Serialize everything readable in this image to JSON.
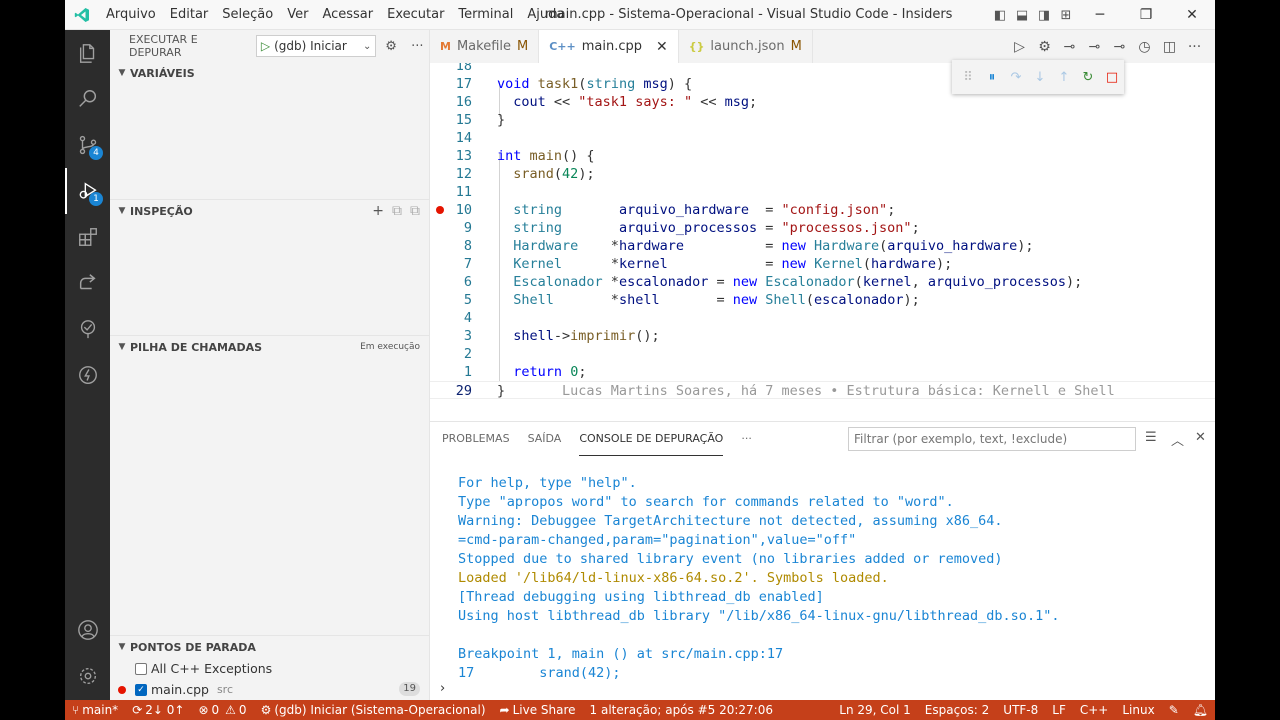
{
  "window_title": "main.cpp - Sistema-Operacional - Visual Studio Code - Insiders",
  "menu": [
    "Arquivo",
    "Editar",
    "Seleção",
    "Ver",
    "Acessar",
    "Executar",
    "Terminal",
    "Ajuda"
  ],
  "activity_badges": {
    "scm": "4",
    "debug": "1"
  },
  "sidebar": {
    "header": "EXECUTAR E DEPURAR",
    "config": "(gdb) Iniciar",
    "sections": {
      "variables": "VARIÁVEIS",
      "watch": "INSPEÇÃO",
      "callstack": "PILHA DE CHAMADAS",
      "callstack_status": "Em execução",
      "breakpoints": "PONTOS DE PARADA"
    },
    "breakpoints": [
      {
        "label": "All C++ Exceptions",
        "checked": false
      },
      {
        "label": "main.cpp",
        "path": "src",
        "line": "19",
        "checked": true
      }
    ]
  },
  "tabs": [
    {
      "icon": "M",
      "label": "Makefile",
      "status": "M",
      "active": false
    },
    {
      "icon": "C++",
      "label": "main.cpp",
      "status": "",
      "active": true
    },
    {
      "icon": "{}",
      "label": "launch.json",
      "status": "M",
      "active": false
    }
  ],
  "code_lines": [
    {
      "n": "18",
      "html": ""
    },
    {
      "n": "17",
      "html": "<span class='kw'>void</span> <span class='fn'>task1</span>(<span class='ty'>string</span> <span class='var'>msg</span>) {"
    },
    {
      "n": "16",
      "html": "  <span class='var'>cout</span> &lt;&lt; <span class='str'>\"task1 says: \"</span> &lt;&lt; <span class='var'>msg</span>;"
    },
    {
      "n": "15",
      "html": "}"
    },
    {
      "n": "14",
      "html": ""
    },
    {
      "n": "13",
      "html": "<span class='kw'>int</span> <span class='fn'>main</span>() {"
    },
    {
      "n": "12",
      "html": "  <span class='fn'>srand</span>(<span class='num'>42</span>);"
    },
    {
      "n": "11",
      "html": ""
    },
    {
      "n": "10",
      "html": "  <span class='ty'>string</span>       <span class='var'>arquivo_hardware</span>  = <span class='str'>\"config.json\"</span>;",
      "bp": true
    },
    {
      "n": "9",
      "html": "  <span class='ty'>string</span>       <span class='var'>arquivo_processos</span> = <span class='str'>\"processos.json\"</span>;"
    },
    {
      "n": "8",
      "html": "  <span class='ty'>Hardware</span>    *<span class='var'>hardware</span>          = <span class='kw'>new</span> <span class='ty'>Hardware</span>(<span class='var'>arquivo_hardware</span>);"
    },
    {
      "n": "7",
      "html": "  <span class='ty'>Kernel</span>      *<span class='var'>kernel</span>            = <span class='kw'>new</span> <span class='ty'>Kernel</span>(<span class='var'>hardware</span>);"
    },
    {
      "n": "6",
      "html": "  <span class='ty'>Escalonador</span> *<span class='var'>escalonador</span> = <span class='kw'>new</span> <span class='ty'>Escalonador</span>(<span class='var'>kernel</span>, <span class='var'>arquivo_processos</span>);"
    },
    {
      "n": "5",
      "html": "  <span class='ty'>Shell</span>       *<span class='var'>shell</span>       = <span class='kw'>new</span> <span class='ty'>Shell</span>(<span class='var'>escalonador</span>);"
    },
    {
      "n": "4",
      "html": ""
    },
    {
      "n": "3",
      "html": "  <span class='var'>shell</span>-&gt;<span class='fn'>imprimir</span>();"
    },
    {
      "n": "2",
      "html": ""
    },
    {
      "n": "1",
      "html": "  <span class='kw'>return</span> <span class='num'>0</span>;"
    },
    {
      "n": "29",
      "html": "}       <span class='blame'>Lucas Martins Soares, há 7 meses • Estrutura básica: Kernell e Shell</span>",
      "current": true
    }
  ],
  "panel": {
    "tabs": [
      "PROBLEMAS",
      "SAÍDA",
      "CONSOLE DE DEPURAÇÃO"
    ],
    "filter_placeholder": "Filtrar (por exemplo, text, !exclude)",
    "console": [
      {
        "t": "For help, type \"help\".",
        "c": "info"
      },
      {
        "t": "Type \"apropos word\" to search for commands related to \"word\".",
        "c": "info"
      },
      {
        "t": "Warning: Debuggee TargetArchitecture not detected, assuming x86_64.",
        "c": "info"
      },
      {
        "t": "=cmd-param-changed,param=\"pagination\",value=\"off\"",
        "c": "info"
      },
      {
        "t": "Stopped due to shared library event (no libraries added or removed)",
        "c": "info"
      },
      {
        "t": "Loaded '/lib64/ld-linux-x86-64.so.2'. Symbols loaded.",
        "c": "warn"
      },
      {
        "t": "[Thread debugging using libthread_db enabled]",
        "c": "info"
      },
      {
        "t": "Using host libthread_db library \"/lib/x86_64-linux-gnu/libthread_db.so.1\".",
        "c": "info"
      },
      {
        "t": "",
        "c": "info"
      },
      {
        "t": "Breakpoint 1, main () at src/main.cpp:17",
        "c": "info"
      },
      {
        "t": "17        srand(42);",
        "c": "info"
      }
    ]
  },
  "status": {
    "branch": "main*",
    "sync": "2↓ 0↑",
    "problems": "0",
    "warnings": "0",
    "debug_config": "(gdb) Iniciar (Sistema-Operacional)",
    "live_share": "Live Share",
    "changes": "1 alteração; após #5  20:27:06",
    "position": "Ln 29, Col 1",
    "spaces": "Espaços: 2",
    "encoding": "UTF-8",
    "eol": "LF",
    "language": "C++",
    "os": "Linux"
  },
  "colors": {
    "statusbar": "#c5401a",
    "activitybar": "#2c2c2c",
    "accent": "#1a85d4"
  }
}
